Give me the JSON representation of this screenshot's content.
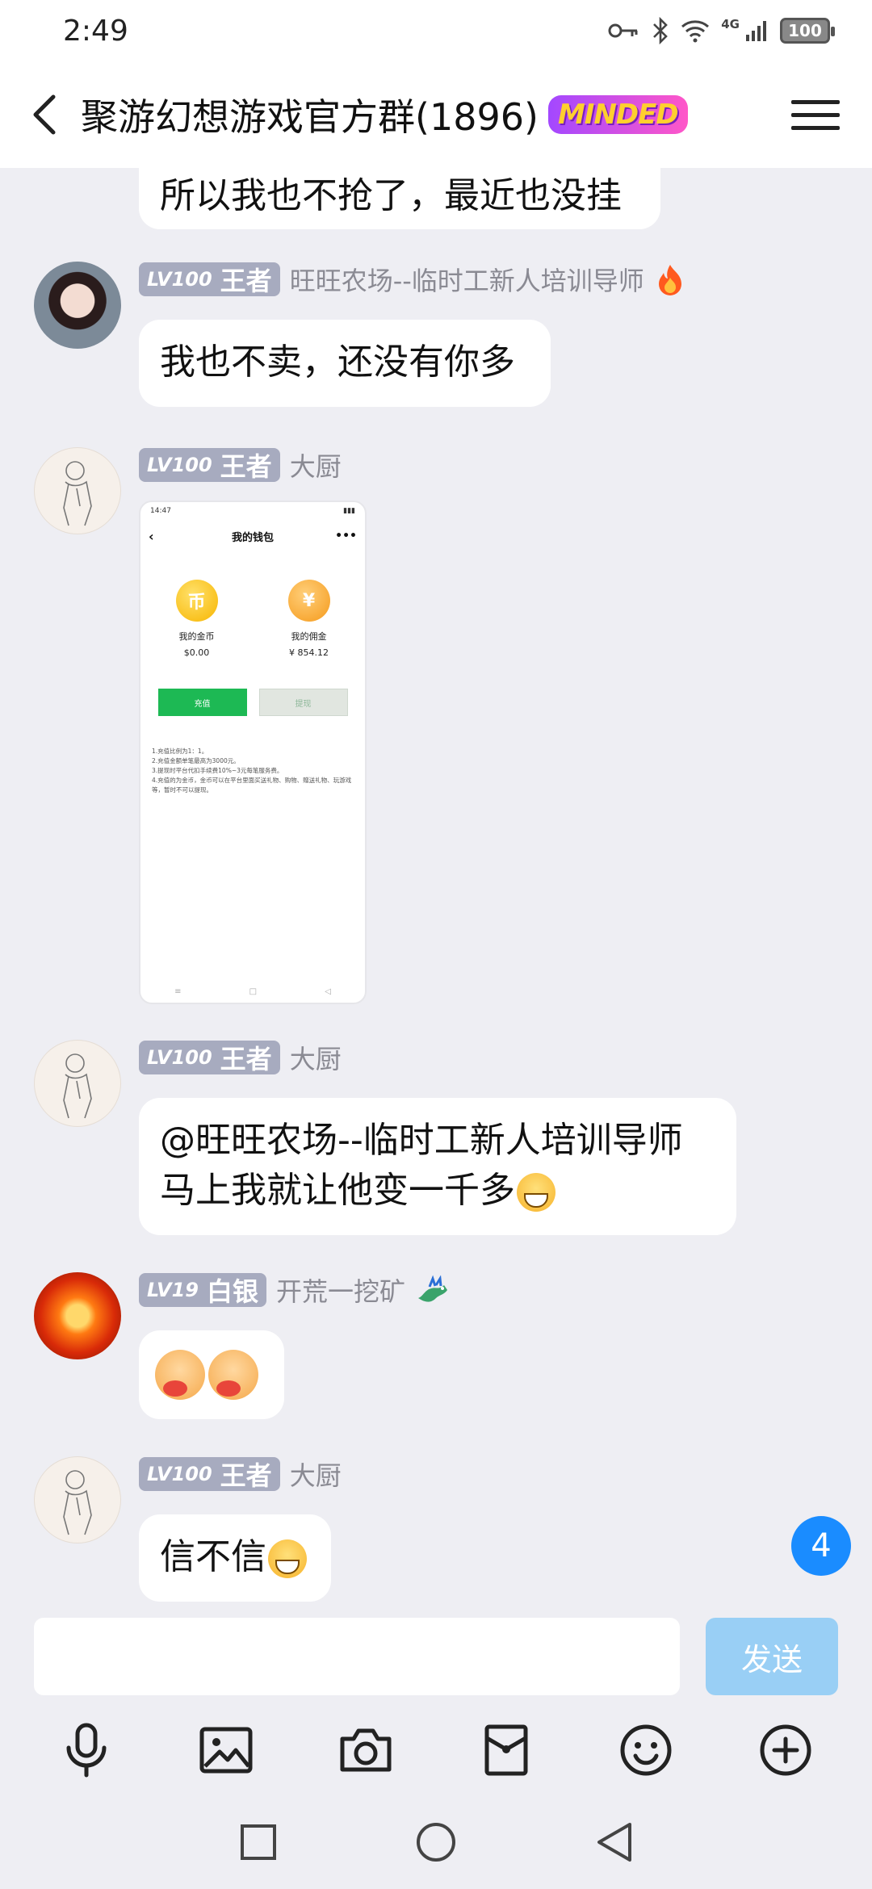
{
  "status_bar": {
    "time": "2:49",
    "battery": "100",
    "network": "4G"
  },
  "header": {
    "title": "聚游幻想游戏官方群(1896)",
    "badge": "MINDED"
  },
  "messages": [
    {
      "type": "text",
      "text": "所以我也不抢了，最近也没挂"
    },
    {
      "type": "text",
      "level": "LV100",
      "rank": "王者",
      "sender": "旺旺农场--临时工新人培训导师",
      "sender_icon": "fire-icon",
      "text": "我也不卖，还没有你多"
    },
    {
      "type": "image",
      "level": "LV100",
      "rank": "王者",
      "sender": "大厨",
      "image": {
        "status_time": "14:47",
        "title": "我的钱包",
        "coin_glyph": "币",
        "yen_glyph": "¥",
        "coin_label": "我的金币",
        "coin_value": "$0.00",
        "commission_label": "我的佣金",
        "commission_value": "¥ 854.12",
        "recharge_label": "充值",
        "withdraw_label": "提现",
        "notes": [
          "1.充值比例为1：1。",
          "2.充值金额单笔最高为3000元。",
          "3.提现时平台代扣手续费10%~3元每笔服务费。",
          "4.充值的为金币，金币可以在平台里面买送礼物、购物、赠送礼物、玩游戏等，暂时不可以提现。"
        ]
      }
    },
    {
      "type": "text",
      "level": "LV100",
      "rank": "王者",
      "sender": "大厨",
      "line1": "@旺旺农场--临时工新人培训导师",
      "line2": "马上我就让他变一千多"
    },
    {
      "type": "emoji",
      "level": "LV19",
      "rank": "白银",
      "sender": "开荒一挖矿",
      "sender_icon": "dragon-icon"
    },
    {
      "type": "text",
      "level": "LV100",
      "rank": "王者",
      "sender": "大厨",
      "text": "信不信"
    }
  ],
  "unread_count": "4",
  "input": {
    "value": "",
    "placeholder": "",
    "send_label": "发送"
  },
  "toolbar": [
    "microphone-icon",
    "image-icon",
    "camera-icon",
    "red-packet-icon",
    "emoji-icon",
    "plus-icon"
  ],
  "colors": {
    "accent": "#1a8cff",
    "send_disabled": "#99cff5",
    "background": "#eeeef3",
    "level_badge": "#a7abbf"
  }
}
